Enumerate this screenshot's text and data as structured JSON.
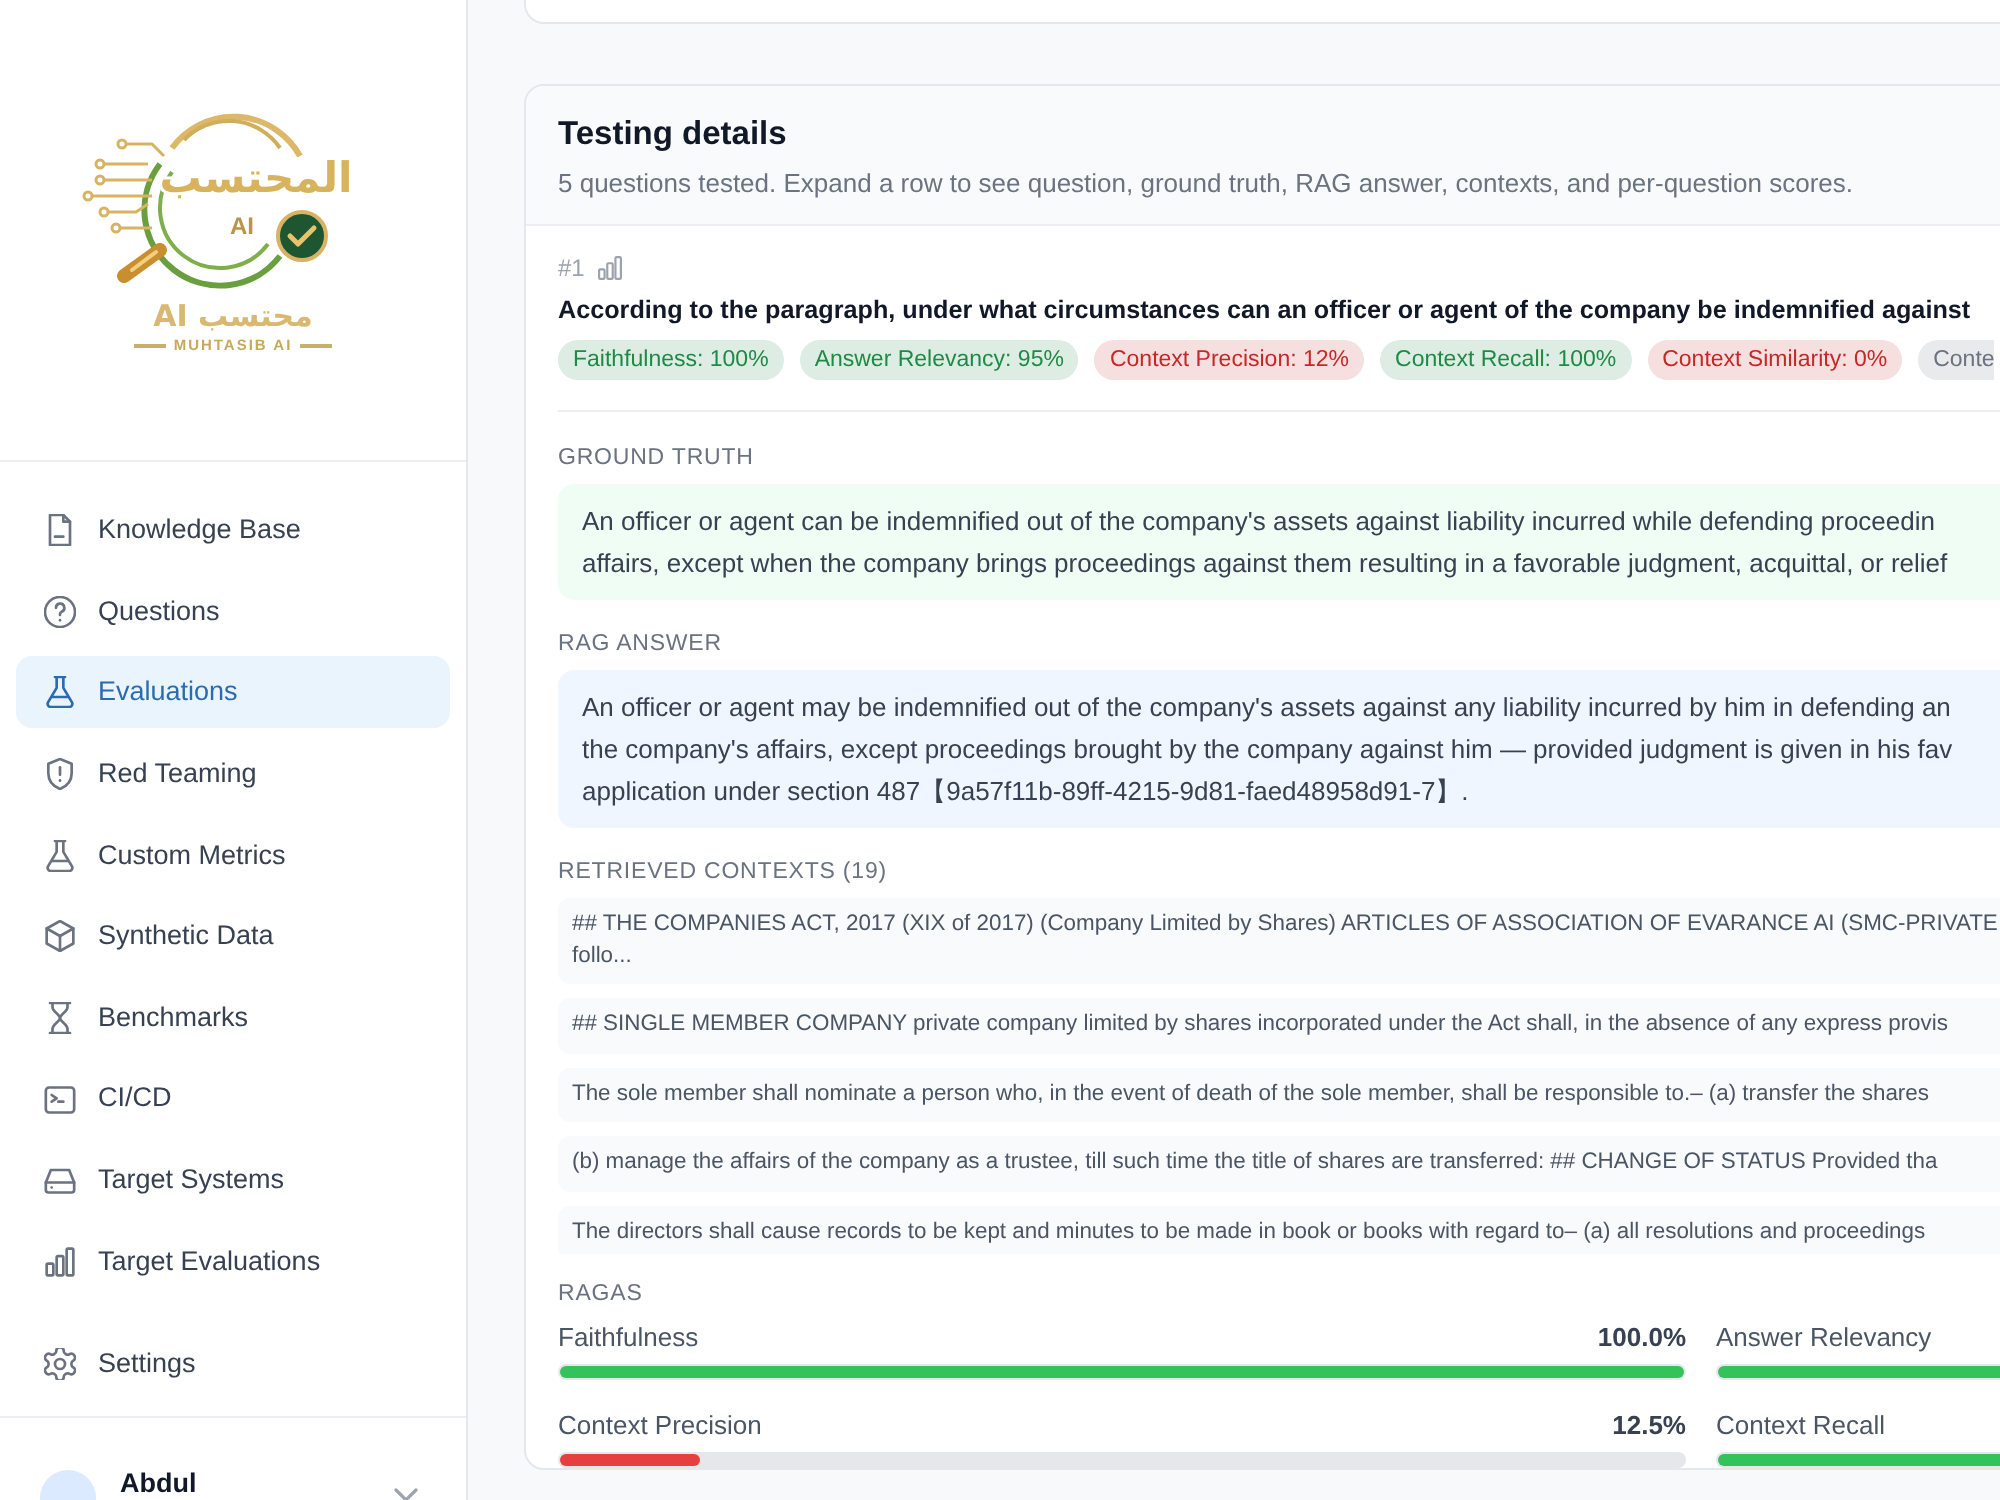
{
  "sidebar": {
    "logo": {
      "arabic_title": "المحتسب",
      "emblem_text": "AI",
      "arabic_wordmark": "محتسب AI",
      "tagline": "MUHTASIB AI"
    },
    "nav_items": [
      {
        "label": "Knowledge Base",
        "selected": false
      },
      {
        "label": "Questions",
        "selected": false
      },
      {
        "label": "Evaluations",
        "selected": true
      },
      {
        "label": "Red Teaming",
        "selected": false
      },
      {
        "label": "Custom Metrics",
        "selected": false
      },
      {
        "label": "Synthetic Data",
        "selected": false
      },
      {
        "label": "Benchmarks",
        "selected": false
      },
      {
        "label": "CI/CD",
        "selected": false
      },
      {
        "label": "Target Systems",
        "selected": false
      },
      {
        "label": "Target Evaluations",
        "selected": false
      }
    ],
    "settings_item": {
      "label": "Settings",
      "selected": false
    },
    "user": {
      "name": "Abdul"
    }
  },
  "testing_details": {
    "title": "Testing details",
    "subtitle": "5 questions tested. Expand a row to see question, ground truth, RAG answer, contexts, and per-question scores.",
    "question": {
      "number": "#1",
      "text": "According to the paragraph, under what circumstances can an officer or agent of the company be indemnified against",
      "scores": [
        {
          "label": "Faithfulness: 100%",
          "color": "#1f8a45"
        },
        {
          "label": "Answer Relevancy: 95%",
          "color": "#1f8a45"
        },
        {
          "label": "Context Precision: 12%",
          "color": "#c62828"
        },
        {
          "label": "Context Recall: 100%",
          "color": "#1f8a45"
        },
        {
          "label": "Context Similarity: 0%",
          "color": "#c62828"
        },
        {
          "label": "Conte",
          "color": "#6b7280"
        }
      ]
    },
    "ground_truth": {
      "heading": "GROUND TRUTH",
      "lines": [
        "An officer or agent can be indemnified out of the company's assets against liability incurred while defending proceedin",
        "affairs, except when the company brings proceedings against them resulting in a favorable judgment, acquittal, or relief"
      ]
    },
    "rag_answer": {
      "heading": "RAG ANSWER",
      "lines": [
        "An officer or agent may be indemnified out of the company's assets against any liability incurred by him in defending an",
        "the company's affairs, except proceedings brought by the company against him — provided judgment is given in his fav",
        "application under section 487【9a57f11b-89ff-4215-9d81-faed48958d91-7】."
      ]
    },
    "contexts": {
      "heading": "RETRIEVED CONTEXTS (19)",
      "items": [
        {
          "lines": [
            "## THE COMPANIES ACT, 2017 (XIX of 2017) (Company Limited by Shares) ARTICLES OF ASSOCIATION OF EVARANCE AI (SMC-PRIVATE",
            "follo..."
          ]
        },
        {
          "lines": [
            "## SINGLE MEMBER COMPANY private company limited by shares incorporated under the Act shall, in the absence of any express provis"
          ]
        },
        {
          "lines": [
            "The sole member shall nominate a person who, in the event of death of the sole member, shall be responsible to.– (a) transfer the shares"
          ]
        },
        {
          "lines": [
            "(b) manage the affairs of the company as a trustee, till such time the title of shares are transferred: ## CHANGE OF STATUS Provided tha"
          ]
        },
        {
          "lines": [
            "The directors shall cause records to be kept and minutes to be made in book or books with regard to– (a) all resolutions and proceedings"
          ]
        }
      ]
    },
    "ragas": {
      "heading": "RAGAS",
      "metrics": [
        {
          "name": "Faithfulness",
          "value": "100.0%",
          "level": 1.0
        },
        {
          "name": "Answer Relevancy",
          "level": 0.95
        },
        {
          "name": "Context Precision",
          "value": "12.5%",
          "level": 0.125
        },
        {
          "name": "Context Recall",
          "level": 1.0
        }
      ]
    }
  }
}
